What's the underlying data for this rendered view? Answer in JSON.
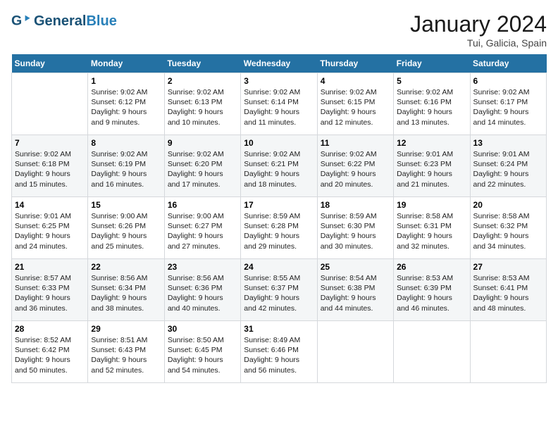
{
  "header": {
    "logo_general": "General",
    "logo_blue": "Blue",
    "month_year": "January 2024",
    "location": "Tui, Galicia, Spain"
  },
  "days_of_week": [
    "Sunday",
    "Monday",
    "Tuesday",
    "Wednesday",
    "Thursday",
    "Friday",
    "Saturday"
  ],
  "weeks": [
    [
      {
        "day": "",
        "info": ""
      },
      {
        "day": "1",
        "info": "Sunrise: 9:02 AM\nSunset: 6:12 PM\nDaylight: 9 hours\nand 9 minutes."
      },
      {
        "day": "2",
        "info": "Sunrise: 9:02 AM\nSunset: 6:13 PM\nDaylight: 9 hours\nand 10 minutes."
      },
      {
        "day": "3",
        "info": "Sunrise: 9:02 AM\nSunset: 6:14 PM\nDaylight: 9 hours\nand 11 minutes."
      },
      {
        "day": "4",
        "info": "Sunrise: 9:02 AM\nSunset: 6:15 PM\nDaylight: 9 hours\nand 12 minutes."
      },
      {
        "day": "5",
        "info": "Sunrise: 9:02 AM\nSunset: 6:16 PM\nDaylight: 9 hours\nand 13 minutes."
      },
      {
        "day": "6",
        "info": "Sunrise: 9:02 AM\nSunset: 6:17 PM\nDaylight: 9 hours\nand 14 minutes."
      }
    ],
    [
      {
        "day": "7",
        "info": "Sunrise: 9:02 AM\nSunset: 6:18 PM\nDaylight: 9 hours\nand 15 minutes."
      },
      {
        "day": "8",
        "info": "Sunrise: 9:02 AM\nSunset: 6:19 PM\nDaylight: 9 hours\nand 16 minutes."
      },
      {
        "day": "9",
        "info": "Sunrise: 9:02 AM\nSunset: 6:20 PM\nDaylight: 9 hours\nand 17 minutes."
      },
      {
        "day": "10",
        "info": "Sunrise: 9:02 AM\nSunset: 6:21 PM\nDaylight: 9 hours\nand 18 minutes."
      },
      {
        "day": "11",
        "info": "Sunrise: 9:02 AM\nSunset: 6:22 PM\nDaylight: 9 hours\nand 20 minutes."
      },
      {
        "day": "12",
        "info": "Sunrise: 9:01 AM\nSunset: 6:23 PM\nDaylight: 9 hours\nand 21 minutes."
      },
      {
        "day": "13",
        "info": "Sunrise: 9:01 AM\nSunset: 6:24 PM\nDaylight: 9 hours\nand 22 minutes."
      }
    ],
    [
      {
        "day": "14",
        "info": "Sunrise: 9:01 AM\nSunset: 6:25 PM\nDaylight: 9 hours\nand 24 minutes."
      },
      {
        "day": "15",
        "info": "Sunrise: 9:00 AM\nSunset: 6:26 PM\nDaylight: 9 hours\nand 25 minutes."
      },
      {
        "day": "16",
        "info": "Sunrise: 9:00 AM\nSunset: 6:27 PM\nDaylight: 9 hours\nand 27 minutes."
      },
      {
        "day": "17",
        "info": "Sunrise: 8:59 AM\nSunset: 6:28 PM\nDaylight: 9 hours\nand 29 minutes."
      },
      {
        "day": "18",
        "info": "Sunrise: 8:59 AM\nSunset: 6:30 PM\nDaylight: 9 hours\nand 30 minutes."
      },
      {
        "day": "19",
        "info": "Sunrise: 8:58 AM\nSunset: 6:31 PM\nDaylight: 9 hours\nand 32 minutes."
      },
      {
        "day": "20",
        "info": "Sunrise: 8:58 AM\nSunset: 6:32 PM\nDaylight: 9 hours\nand 34 minutes."
      }
    ],
    [
      {
        "day": "21",
        "info": "Sunrise: 8:57 AM\nSunset: 6:33 PM\nDaylight: 9 hours\nand 36 minutes."
      },
      {
        "day": "22",
        "info": "Sunrise: 8:56 AM\nSunset: 6:34 PM\nDaylight: 9 hours\nand 38 minutes."
      },
      {
        "day": "23",
        "info": "Sunrise: 8:56 AM\nSunset: 6:36 PM\nDaylight: 9 hours\nand 40 minutes."
      },
      {
        "day": "24",
        "info": "Sunrise: 8:55 AM\nSunset: 6:37 PM\nDaylight: 9 hours\nand 42 minutes."
      },
      {
        "day": "25",
        "info": "Sunrise: 8:54 AM\nSunset: 6:38 PM\nDaylight: 9 hours\nand 44 minutes."
      },
      {
        "day": "26",
        "info": "Sunrise: 8:53 AM\nSunset: 6:39 PM\nDaylight: 9 hours\nand 46 minutes."
      },
      {
        "day": "27",
        "info": "Sunrise: 8:53 AM\nSunset: 6:41 PM\nDaylight: 9 hours\nand 48 minutes."
      }
    ],
    [
      {
        "day": "28",
        "info": "Sunrise: 8:52 AM\nSunset: 6:42 PM\nDaylight: 9 hours\nand 50 minutes."
      },
      {
        "day": "29",
        "info": "Sunrise: 8:51 AM\nSunset: 6:43 PM\nDaylight: 9 hours\nand 52 minutes."
      },
      {
        "day": "30",
        "info": "Sunrise: 8:50 AM\nSunset: 6:45 PM\nDaylight: 9 hours\nand 54 minutes."
      },
      {
        "day": "31",
        "info": "Sunrise: 8:49 AM\nSunset: 6:46 PM\nDaylight: 9 hours\nand 56 minutes."
      },
      {
        "day": "",
        "info": ""
      },
      {
        "day": "",
        "info": ""
      },
      {
        "day": "",
        "info": ""
      }
    ]
  ]
}
